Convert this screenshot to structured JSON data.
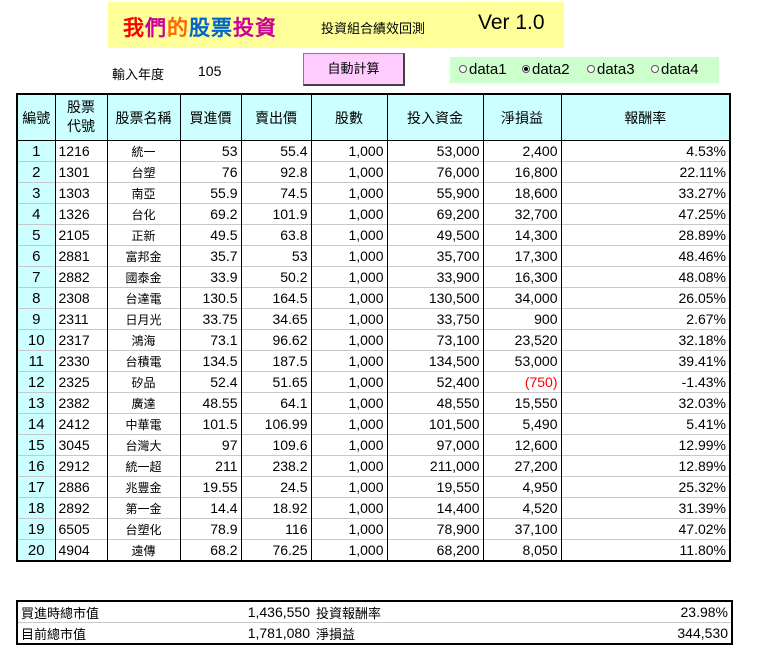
{
  "header": {
    "title_chars": [
      {
        "text": "我",
        "color": "#ff0000"
      },
      {
        "text": "們",
        "color": "#cc0099"
      },
      {
        "text": "的",
        "color": "#ff6600"
      },
      {
        "text": "股",
        "color": "#0066cc"
      },
      {
        "text": "票",
        "color": "#0066cc"
      },
      {
        "text": "投",
        "color": "#cc0099"
      },
      {
        "text": "資",
        "color": "#cc0099"
      }
    ],
    "subtitle": "投資組合績效回測",
    "version": "Ver 1.0"
  },
  "year": {
    "label": "輸入年度",
    "value": "105"
  },
  "calc_button": {
    "label": "自動計算"
  },
  "data_sets": [
    {
      "label": "data1",
      "selected": false
    },
    {
      "label": "data2",
      "selected": true
    },
    {
      "label": "data3",
      "selected": false
    },
    {
      "label": "data4",
      "selected": false
    }
  ],
  "table": {
    "headers": [
      "編號",
      "股票代號",
      "股票名稱",
      "買進價",
      "賣出價",
      "股數",
      "投入資金",
      "淨損益",
      "報酬率"
    ],
    "rows": [
      [
        "1",
        "1216",
        "統一",
        "53",
        "55.4",
        "1,000",
        "53,000",
        "2,400",
        "4.53%"
      ],
      [
        "2",
        "1301",
        "台塑",
        "76",
        "92.8",
        "1,000",
        "76,000",
        "16,800",
        "22.11%"
      ],
      [
        "3",
        "1303",
        "南亞",
        "55.9",
        "74.5",
        "1,000",
        "55,900",
        "18,600",
        "33.27%"
      ],
      [
        "4",
        "1326",
        "台化",
        "69.2",
        "101.9",
        "1,000",
        "69,200",
        "32,700",
        "47.25%"
      ],
      [
        "5",
        "2105",
        "正新",
        "49.5",
        "63.8",
        "1,000",
        "49,500",
        "14,300",
        "28.89%"
      ],
      [
        "6",
        "2881",
        "富邦金",
        "35.7",
        "53",
        "1,000",
        "35,700",
        "17,300",
        "48.46%"
      ],
      [
        "7",
        "2882",
        "國泰金",
        "33.9",
        "50.2",
        "1,000",
        "33,900",
        "16,300",
        "48.08%"
      ],
      [
        "8",
        "2308",
        "台達電",
        "130.5",
        "164.5",
        "1,000",
        "130,500",
        "34,000",
        "26.05%"
      ],
      [
        "9",
        "2311",
        "日月光",
        "33.75",
        "34.65",
        "1,000",
        "33,750",
        "900",
        "2.67%"
      ],
      [
        "10",
        "2317",
        "鴻海",
        "73.1",
        "96.62",
        "1,000",
        "73,100",
        "23,520",
        "32.18%"
      ],
      [
        "11",
        "2330",
        "台積電",
        "134.5",
        "187.5",
        "1,000",
        "134,500",
        "53,000",
        "39.41%"
      ],
      [
        "12",
        "2325",
        "矽品",
        "52.4",
        "51.65",
        "1,000",
        "52,400",
        "(750)",
        "-1.43%"
      ],
      [
        "13",
        "2382",
        "廣達",
        "48.55",
        "64.1",
        "1,000",
        "48,550",
        "15,550",
        "32.03%"
      ],
      [
        "14",
        "2412",
        "中華電",
        "101.5",
        "106.99",
        "1,000",
        "101,500",
        "5,490",
        "5.41%"
      ],
      [
        "15",
        "3045",
        "台灣大",
        "97",
        "109.6",
        "1,000",
        "97,000",
        "12,600",
        "12.99%"
      ],
      [
        "16",
        "2912",
        "統一超",
        "211",
        "238.2",
        "1,000",
        "211,000",
        "27,200",
        "12.89%"
      ],
      [
        "17",
        "2886",
        "兆豐金",
        "19.55",
        "24.5",
        "1,000",
        "19,550",
        "4,950",
        "25.32%"
      ],
      [
        "18",
        "2892",
        "第一金",
        "14.4",
        "18.92",
        "1,000",
        "14,400",
        "4,520",
        "31.39%"
      ],
      [
        "19",
        "6505",
        "台塑化",
        "78.9",
        "116",
        "1,000",
        "78,900",
        "37,100",
        "47.02%"
      ],
      [
        "20",
        "4904",
        "遠傳",
        "68.2",
        "76.25",
        "1,000",
        "68,200",
        "8,050",
        "11.80%"
      ]
    ]
  },
  "summary": {
    "buy_total_label": "買進時總市值",
    "buy_total_value": "1,436,550",
    "return_label": "投資報酬率",
    "return_value": "23.98%",
    "current_total_label": "目前總市值",
    "current_total_value": "1,781,080",
    "net_label": "淨損益",
    "net_value": "344,530"
  }
}
